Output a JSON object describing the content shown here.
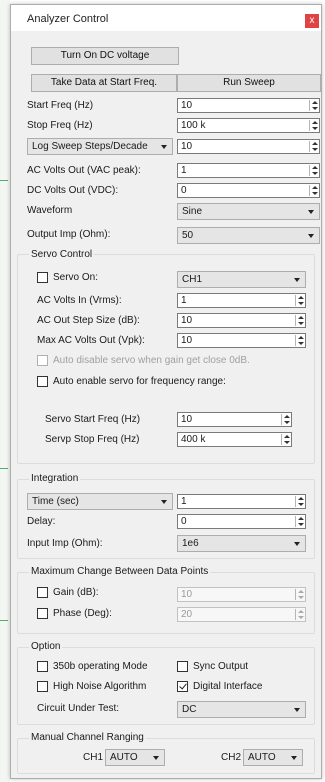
{
  "window": {
    "title": "Analyzer Control",
    "close_glyph": "x"
  },
  "buttons": {
    "turn_on_dc": "Turn On DC voltage",
    "take_data": "Take Data at Start Freq.",
    "run_sweep": "Run Sweep"
  },
  "params": {
    "start_freq_label": "Start Freq (Hz)",
    "start_freq_value": "10",
    "stop_freq_label": "Stop Freq (Hz)",
    "stop_freq_value": "100 k",
    "sweep_mode_selected": "Log Sweep Steps/Decade",
    "sweep_steps_value": "10",
    "ac_volts_label": "AC Volts Out (VAC peak):",
    "ac_volts_value": "1",
    "dc_volts_label": "DC Volts Out (VDC):",
    "dc_volts_value": "0",
    "waveform_label": "Waveform",
    "waveform_selected": "Sine",
    "output_imp_label": "Output Imp (Ohm):",
    "output_imp_selected": "50"
  },
  "servo": {
    "group_title": "Servo Control",
    "servo_on_label": "Servo On:",
    "channel_selected": "CH1",
    "ac_volts_in_label": "AC Volts In (Vrms):",
    "ac_volts_in_value": "1",
    "step_size_label": "AC Out Step Size (dB):",
    "step_size_value": "10",
    "max_ac_label": "Max AC Volts Out (Vpk):",
    "max_ac_value": "10",
    "auto_disable_label": "Auto disable servo when gain get close 0dB.",
    "auto_enable_label": "Auto enable servo for frequency range:",
    "start_freq_label": "Servo Start Freq (Hz)",
    "start_freq_value": "10",
    "stop_freq_label": "Servp Stop Freq (Hz)",
    "stop_freq_value": "400 k"
  },
  "integration": {
    "group_title": "Integration",
    "mode_selected": "Time (sec)",
    "mode_value": "1",
    "delay_label": "Delay:",
    "delay_value": "0",
    "input_imp_label": "Input Imp (Ohm):",
    "input_imp_selected": "1e6"
  },
  "max_change": {
    "group_title": "Maximum Change Between Data Points",
    "gain_label": "Gain (dB):",
    "gain_value": "10",
    "phase_label": "Phase (Deg):",
    "phase_value": "20"
  },
  "option": {
    "group_title": "Option",
    "mode_350b_label": "350b operating Mode",
    "sync_output_label": "Sync Output",
    "high_noise_label": "High Noise Algorithm",
    "digital_interface_label": "Digital Interface",
    "circuit_label": "Circuit Under Test:",
    "circuit_selected": "DC"
  },
  "ranging": {
    "group_title": "Manual Channel Ranging",
    "ch1_label": "CH1",
    "ch1_selected": "AUTO",
    "ch2_label": "CH2",
    "ch2_selected": "AUTO"
  }
}
